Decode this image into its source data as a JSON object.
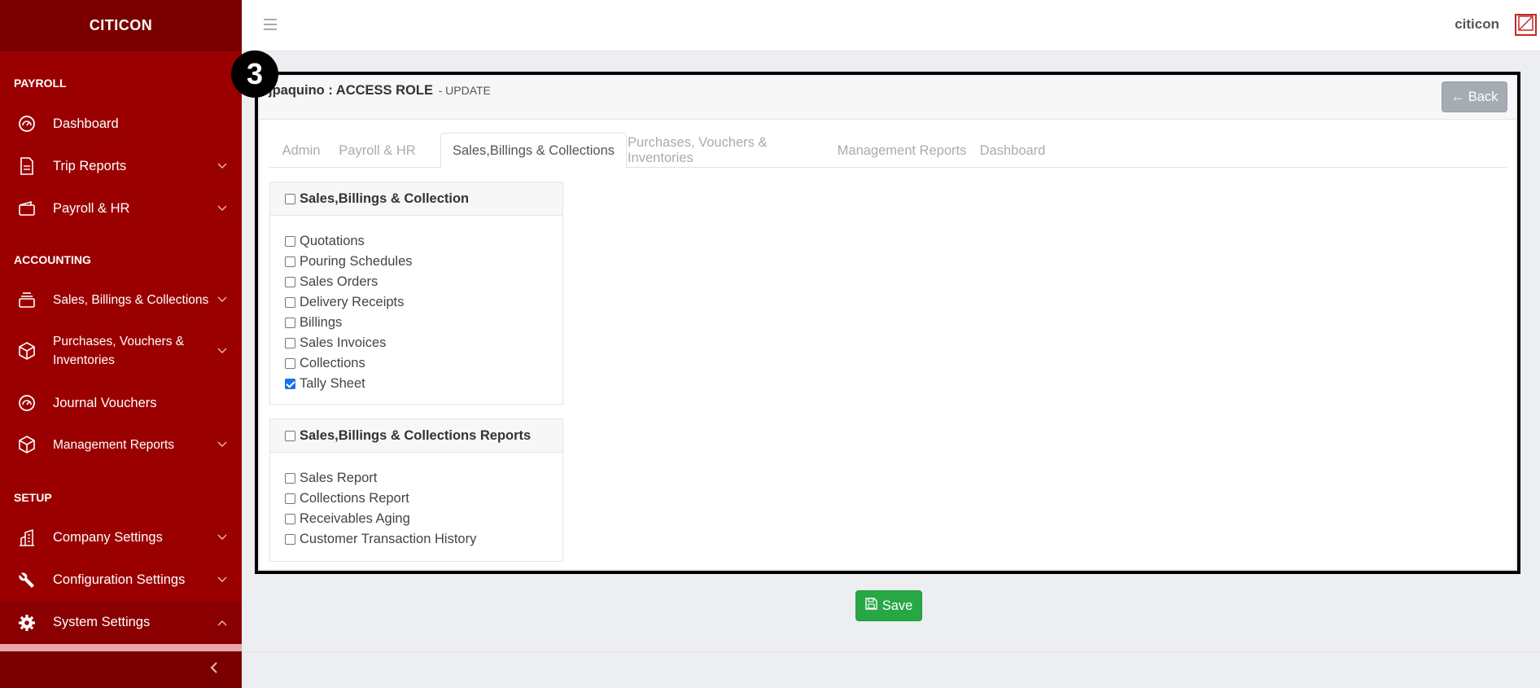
{
  "brand": "CITICON",
  "sidebar": {
    "sections": {
      "payroll": "PAYROLL",
      "accounting": "ACCOUNTING",
      "setup": "SETUP"
    },
    "items": [
      {
        "label": "Dashboard",
        "icon": "gauge-icon"
      },
      {
        "label": "Trip Reports",
        "icon": "document-icon"
      },
      {
        "label": "Payroll & HR",
        "icon": "wallet-icon"
      },
      {
        "label": "Sales, Billings & Collections",
        "icon": "layers-icon"
      },
      {
        "label": "Purchases, Vouchers & Inventories",
        "icon": "box-icon"
      },
      {
        "label": "Journal Vouchers",
        "icon": "gauge-icon"
      },
      {
        "label": "Management Reports",
        "icon": "box-icon"
      },
      {
        "label": "Company Settings",
        "icon": "building-icon"
      },
      {
        "label": "Configuration Settings",
        "icon": "wrench-icon"
      },
      {
        "label": "System Settings",
        "icon": "gear-icon"
      }
    ]
  },
  "topbar": {
    "user": "citicon"
  },
  "badge": "3",
  "card": {
    "title": "jpaquino : ACCESS ROLE",
    "subtitle": "- UPDATE",
    "back_label": "← Back"
  },
  "tabs": [
    {
      "label": "Admin"
    },
    {
      "label": "Payroll & HR"
    },
    {
      "label": "Sales,Billings & Collections"
    },
    {
      "label": "Purchases, Vouchers & Inventories"
    },
    {
      "label": "Management Reports"
    },
    {
      "label": "Dashboard"
    }
  ],
  "panels": [
    {
      "title": "Sales,Billings & Collection",
      "items": [
        {
          "label": "Quotations",
          "checked": false
        },
        {
          "label": "Pouring Schedules",
          "checked": false
        },
        {
          "label": "Sales Orders",
          "checked": false
        },
        {
          "label": "Delivery Receipts",
          "checked": false
        },
        {
          "label": "Billings",
          "checked": false
        },
        {
          "label": "Sales Invoices",
          "checked": false
        },
        {
          "label": "Collections",
          "checked": false
        },
        {
          "label": "Tally Sheet",
          "checked": true
        }
      ]
    },
    {
      "title": "Sales,Billings & Collections Reports",
      "items": [
        {
          "label": "Sales Report",
          "checked": false
        },
        {
          "label": "Collections Report",
          "checked": false
        },
        {
          "label": "Receivables Aging",
          "checked": false
        },
        {
          "label": "Customer Transaction History",
          "checked": false
        }
      ]
    }
  ],
  "save_label": "Save",
  "colors": {
    "sidebar": "#9b0000",
    "sidebar_dark": "#7a0000",
    "save": "#28a745",
    "back": "#a6acb4",
    "check": "#1a73e8"
  }
}
